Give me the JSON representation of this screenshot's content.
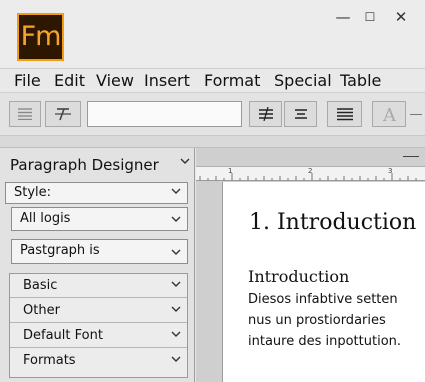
{
  "app": {
    "logo_text": "Fm",
    "minimize": "—",
    "maximize": "☐",
    "close": "✕"
  },
  "menu": [
    "File",
    "Edit",
    "View",
    "Insert",
    "Format",
    "Special",
    "Table"
  ],
  "toolbar": {
    "buttons": [
      "paragraph-list-icon",
      "clear-format-icon",
      "text-field",
      "strikethrough-align-icon",
      "align-center-icon",
      "align-justify-icon",
      "text-style-a-icon"
    ],
    "input_value": ""
  },
  "panel": {
    "title": "Paragraph Designer",
    "style_label": "Style:",
    "dropdown1": "All logis",
    "dropdown2": "Pastgraph is",
    "groups": [
      "Basic",
      "Other",
      "Default Font",
      "Formats"
    ]
  },
  "ruler": {
    "marks": [
      "1",
      "2",
      "3"
    ]
  },
  "document": {
    "heading1": "1. Introduction",
    "heading2": "Introduction",
    "body_lines": [
      "Diesos infabtive setten",
      "nus un prostiordaries",
      "intaure des inpottution."
    ]
  },
  "colors": {
    "logo_bg": "#2d1700",
    "logo_border": "#f39c12",
    "logo_text": "#f7a52a"
  }
}
